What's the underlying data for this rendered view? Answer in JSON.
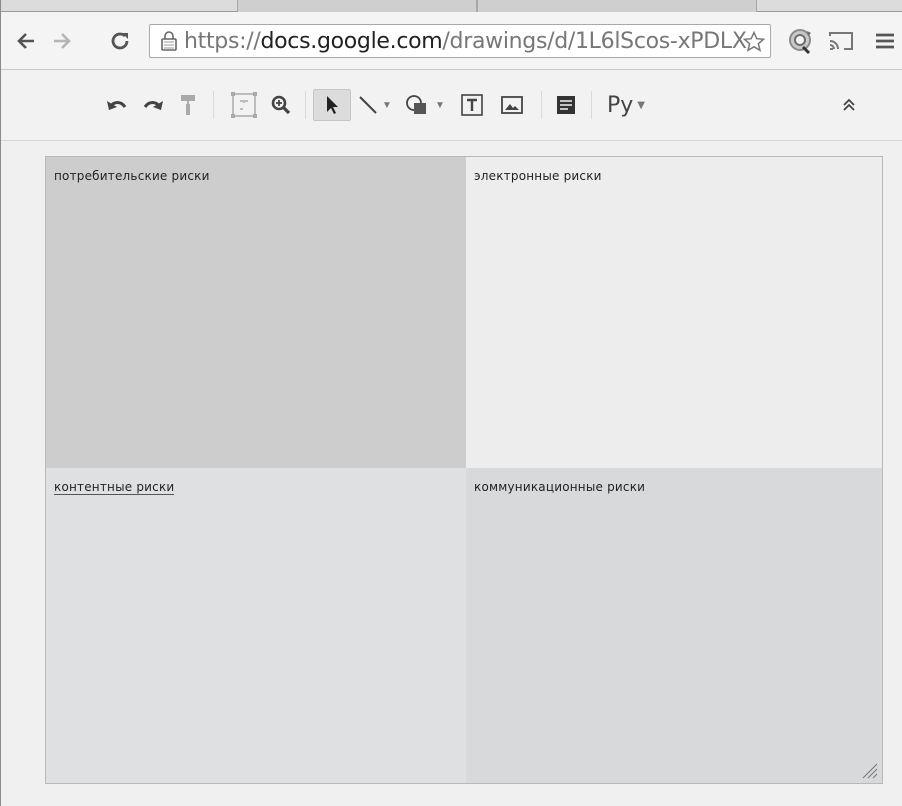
{
  "browser": {
    "url_prefix": "https://",
    "url_host": "docs.google.com",
    "url_path": "/drawings/d/1L6lScos-xPDLX"
  },
  "toolbar": {
    "language_label": "Ру"
  },
  "canvas": {
    "quadrants": [
      {
        "label": "потребительские риски"
      },
      {
        "label": "электронные риски"
      },
      {
        "label": "контентные риски"
      },
      {
        "label": "коммуникационные риски"
      }
    ]
  },
  "icons": {
    "back": "back-arrow-icon",
    "forward": "forward-arrow-icon",
    "reload": "reload-icon",
    "lock": "lock-icon",
    "star": "star-icon",
    "extension": "extension-icon",
    "cast": "cast-icon",
    "menu": "menu-icon",
    "undo": "undo-icon",
    "redo": "redo-icon",
    "paint_format": "paint-format-icon",
    "fit": "fit-select-icon",
    "zoom": "zoom-icon",
    "select": "select-arrow-icon",
    "line": "line-icon",
    "shape": "shape-icon",
    "text_box": "text-box-icon",
    "image": "image-icon",
    "comment": "comment-icon",
    "collapse": "collapse-icon"
  }
}
